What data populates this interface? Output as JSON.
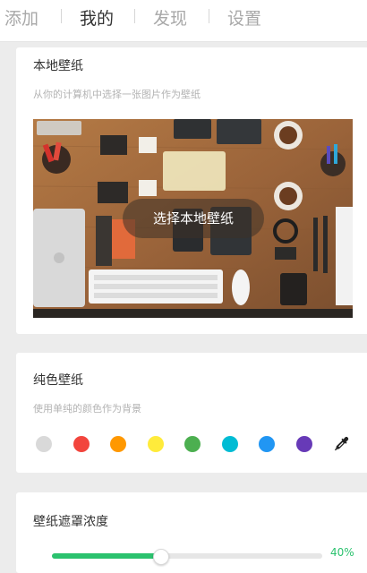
{
  "nav": {
    "tabs": [
      {
        "label": "添加",
        "active": false
      },
      {
        "label": "我的",
        "active": true
      },
      {
        "label": "发现",
        "active": false
      },
      {
        "label": "设置",
        "active": false
      }
    ]
  },
  "local_wallpaper": {
    "title": "本地壁纸",
    "subtitle": "从你的计算机中选择一张图片作为壁纸",
    "choose_button": "选择本地壁纸"
  },
  "solid_wallpaper": {
    "title": "纯色壁纸",
    "subtitle": "使用单纯的颜色作为背景",
    "swatches": [
      {
        "name": "light-gray",
        "color": "#d9d9d9"
      },
      {
        "name": "red",
        "color": "#f2453d"
      },
      {
        "name": "orange",
        "color": "#ff9800"
      },
      {
        "name": "yellow",
        "color": "#ffeb3b"
      },
      {
        "name": "green",
        "color": "#4caf50"
      },
      {
        "name": "cyan",
        "color": "#00bcd4"
      },
      {
        "name": "blue",
        "color": "#2196f3"
      },
      {
        "name": "purple",
        "color": "#673ab7"
      }
    ],
    "picker_icon": "eyedropper-icon"
  },
  "mask_opacity": {
    "title": "壁纸遮罩浓度",
    "value_label": "40%",
    "fraction": 0.4,
    "accent_color": "#2bc26e"
  }
}
